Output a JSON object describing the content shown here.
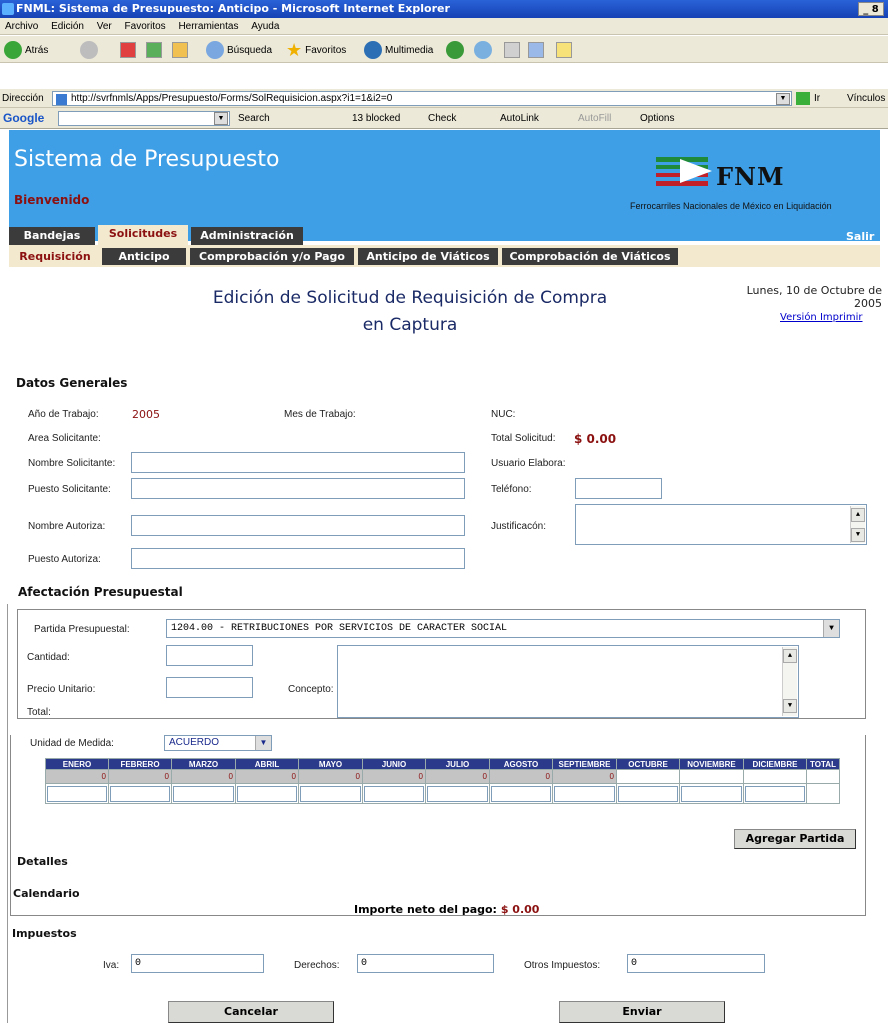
{
  "window": {
    "title": "FNML: Sistema de Presupuesto: Anticipo - Microsoft Internet Explorer",
    "controls": "_ 8"
  },
  "menu": [
    "Archivo",
    "Edición",
    "Ver",
    "Favoritos",
    "Herramientas",
    "Ayuda"
  ],
  "toolbar": {
    "back": "Atrás",
    "search": "Búsqueda",
    "favorites": "Favoritos",
    "multimedia": "Multimedia"
  },
  "address": {
    "label": "Dirección",
    "url": "http://svrfnmls/Apps/Presupuesto/Forms/SolRequisicion.aspx?i1=1&i2=0",
    "go": "Ir",
    "links": "Vínculos"
  },
  "google": {
    "logo": "Google",
    "search": "Search",
    "blocked": "13 blocked",
    "check": "Check",
    "autolink": "AutoLink",
    "autofill": "AutoFill",
    "options": "Options"
  },
  "app": {
    "title": "Sistema de Presupuesto",
    "welcome": "Bienvenido",
    "logo_text": "FNM",
    "org": "Ferrocarriles Nacionales de México en Liquidación",
    "logout": "Salir",
    "brand_color": "#3f9fe6",
    "accent_color": "#8b1010"
  },
  "nav": {
    "tabs": [
      "Bandejas",
      "Solicitudes",
      "Administración"
    ],
    "active_tab": "Solicitudes",
    "subtabs": [
      "Requisición",
      "Anticipo",
      "Comprobación y/o Pago",
      "Anticipo de Viáticos",
      "Comprobación de Viáticos"
    ],
    "active_subtab": "Requisición"
  },
  "form": {
    "title_line1": "Edición de Solicitud de Requisición de Compra",
    "title_line2": "en Captura",
    "date_line1": "Lunes, 10 de Octubre de",
    "date_line2": "2005",
    "print_link": "Versión Imprimir"
  },
  "general": {
    "section": "Datos Generales",
    "anio_label": "Año de Trabajo:",
    "anio_value": "2005",
    "mes_label": "Mes de Trabajo:",
    "nuc_label": "NUC:",
    "area_label": "Area Solicitante:",
    "total_label": "Total Solicitud:",
    "total_value": "$ 0.00",
    "nombre_sol_label": "Nombre Solicitante:",
    "usuario_label": "Usuario Elabora:",
    "puesto_sol_label": "Puesto Solicitante:",
    "telefono_label": "Teléfono:",
    "nombre_aut_label": "Nombre Autoriza:",
    "justificacion_label": "Justificacón:",
    "puesto_aut_label": "Puesto Autoriza:"
  },
  "afectacion": {
    "section": "Afectación Presupuestal",
    "partida_label": "Partida Presupuestal:",
    "partida_value": "1204.00 - RETRIBUCIONES POR SERVICIOS DE CARACTER SOCIAL",
    "cantidad_label": "Cantidad:",
    "precio_label": "Precio Unitario:",
    "concepto_label": "Concepto:",
    "total_label": "Total:",
    "unidad_label": "Unidad de Medida:",
    "unidad_value": "ACUERDO",
    "months": [
      "ENERO",
      "FEBRERO",
      "MARZO",
      "ABRIL",
      "MAYO",
      "JUNIO",
      "JULIO",
      "AGOSTO",
      "SEPTIEMBRE",
      "OCTUBRE",
      "NOVIEMBRE",
      "DICIEMBRE",
      "TOTAL"
    ],
    "month_values": [
      "0",
      "0",
      "0",
      "0",
      "0",
      "0",
      "0",
      "0",
      "0"
    ],
    "add_button": "Agregar Partida",
    "detalles": "Detalles",
    "calendario": "Calendario",
    "importe_label": "Importe neto del pago:",
    "importe_value": "$ 0.00"
  },
  "impuestos": {
    "section": "Impuestos",
    "iva_label": "Iva:",
    "iva_value": "0",
    "derechos_label": "Derechos:",
    "derechos_value": "0",
    "otros_label": "Otros Impuestos:",
    "otros_value": "0"
  },
  "actions": {
    "cancel": "Cancelar",
    "send": "Enviar"
  }
}
